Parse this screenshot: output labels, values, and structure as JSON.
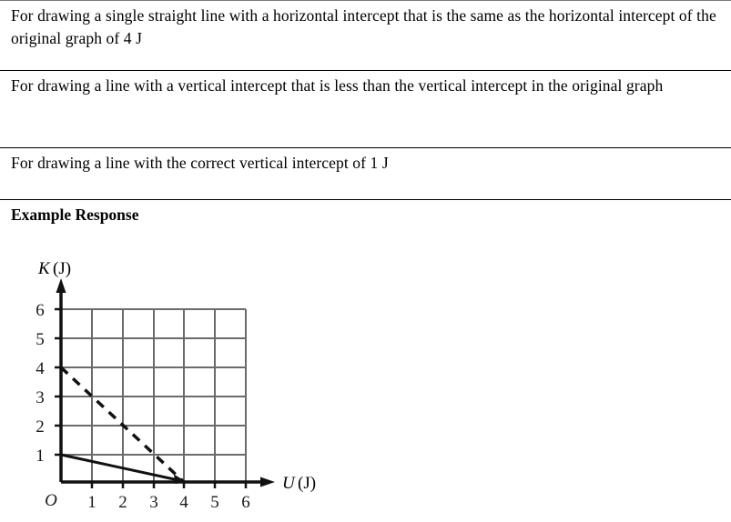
{
  "rubric": {
    "rows": [
      {
        "id": "row-horizontal-intercept",
        "text": "For drawing a single straight line with a horizontal intercept that is the same as the horizontal intercept of the original graph of 4 J"
      },
      {
        "id": "row-vertical-intercept-less",
        "text": "For drawing a line with a vertical intercept that is less than the vertical intercept in the original graph"
      },
      {
        "id": "row-correct-vertical-intercept",
        "text": "For drawing a line with the correct vertical intercept of 1 J"
      }
    ],
    "example_heading": "Example Response"
  },
  "colors": {
    "text": "#000000",
    "rule": "#000000",
    "grid": "#6b6b6b",
    "axis": "#111111",
    "series_solid": "#111111",
    "series_dashed": "#111111"
  },
  "chart_data": {
    "type": "line",
    "title": "",
    "xlabel": "U (J)",
    "ylabel": "K (J)",
    "xlabel_symbol": "U",
    "xlabel_unit": "(J)",
    "ylabel_symbol": "K",
    "ylabel_unit": "(J)",
    "origin_label": "O",
    "xlim": [
      0,
      6
    ],
    "ylim": [
      0,
      6
    ],
    "xticks": [
      1,
      2,
      3,
      4,
      5,
      6
    ],
    "yticks": [
      1,
      2,
      3,
      4,
      5,
      6
    ],
    "xtick_labels": [
      "1",
      "2",
      "3",
      "4",
      "5",
      "6"
    ],
    "ytick_labels": [
      "1",
      "2",
      "3",
      "4",
      "5",
      "6"
    ],
    "grid": true,
    "legend": "none",
    "series": [
      {
        "name": "original graph",
        "style": "dashed",
        "arrow": false,
        "points": [
          [
            0,
            4
          ],
          [
            4,
            0
          ]
        ],
        "vertical_intercept": 4,
        "horizontal_intercept": 4
      },
      {
        "name": "example response",
        "style": "solid",
        "arrow": true,
        "points": [
          [
            0,
            1
          ],
          [
            4,
            0
          ]
        ],
        "vertical_intercept": 1,
        "horizontal_intercept": 4
      }
    ]
  }
}
